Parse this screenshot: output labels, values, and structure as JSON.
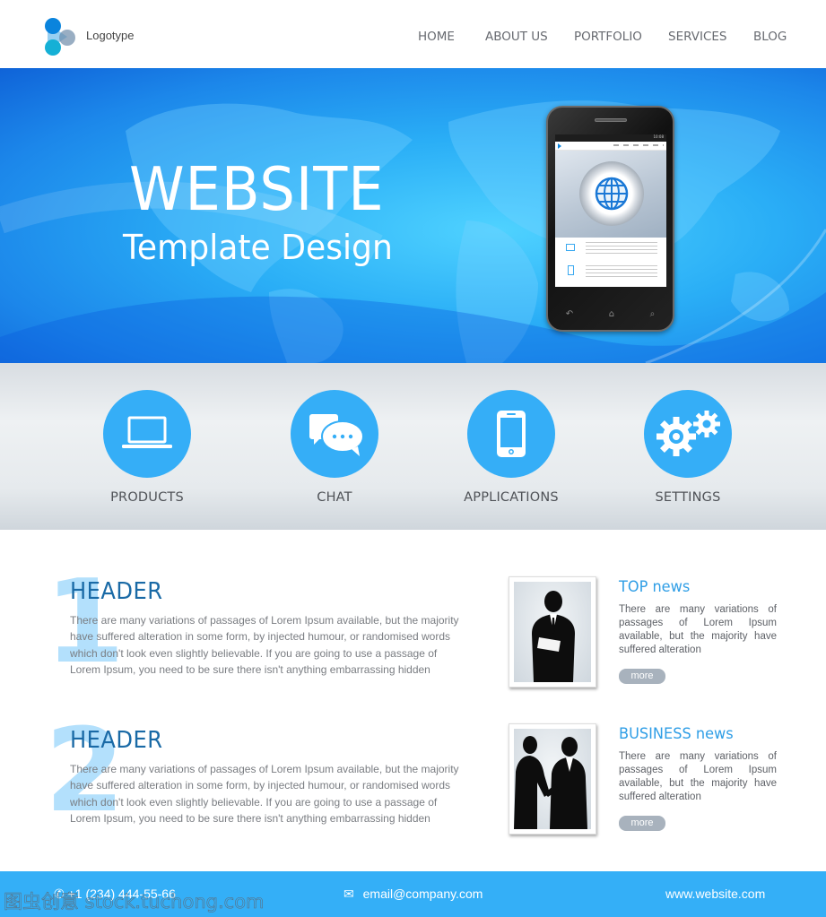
{
  "header": {
    "logo_text": "Logotype",
    "nav": [
      {
        "label": "HOME"
      },
      {
        "label": "ABOUT US"
      },
      {
        "label": "PORTFOLIO"
      },
      {
        "label": "SERVICES"
      },
      {
        "label": "BLOG"
      }
    ]
  },
  "hero": {
    "title": "WEBSITE",
    "subtitle": "Template Design",
    "phone": {
      "status_time": "10:08",
      "screen_icon": "globe-icon",
      "buttons": [
        "back-icon",
        "home-icon",
        "search-icon"
      ]
    }
  },
  "features": [
    {
      "label": "PRODUCTS",
      "icon": "laptop-icon"
    },
    {
      "label": "CHAT",
      "icon": "chat-bubbles-icon"
    },
    {
      "label": "APPLICATIONS",
      "icon": "smartphone-icon"
    },
    {
      "label": "SETTINGS",
      "icon": "gears-icon"
    }
  ],
  "articles": [
    {
      "number": "1",
      "title": "HEADER",
      "body": "There are many variations of passages of Lorem Ipsum available, but the majority have suffered alteration in some form, by injected humour, or randomised words which don't look even slightly believable. If you are going to use a passage of Lorem Ipsum, you need to be sure there isn't anything embarrassing hidden"
    },
    {
      "number": "2",
      "title": "HEADER",
      "body": "There are many variations of passages of Lorem Ipsum available, but the majority have suffered alteration in some form, by injected humour, or randomised words which don't look even slightly believable. If you are going to use a passage of Lorem Ipsum, you need to be sure there isn't anything embarrassing hidden"
    }
  ],
  "news": [
    {
      "title": "TOP news",
      "body": "There are many variations of passages of Lorem Ipsum available, but the majority have suffered alteration",
      "more_label": "more",
      "photo": "businessman-silhouette"
    },
    {
      "title": "BUSINESS news",
      "body": "There are many variations of passages of Lorem Ipsum available, but the majority have suffered alteration",
      "more_label": "more",
      "photo": "handshake-silhouette"
    }
  ],
  "footer": {
    "phone": "+1 (234) 444-55-66",
    "email": "email@company.com",
    "website": "www.website.com"
  },
  "watermark": "图虫创意 stock.tuchong.com",
  "colors": {
    "accent": "#34aff7",
    "header_blue": "#1a6aa6",
    "number_light": "#b3e0fc",
    "nav_text": "#676a70",
    "more_button": "#a8b2bd"
  }
}
